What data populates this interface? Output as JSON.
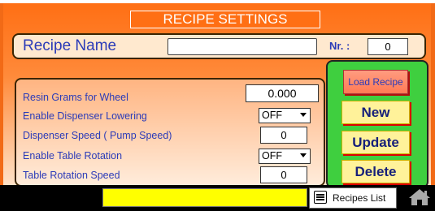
{
  "title": "RECIPE SETTINGS",
  "recipe": {
    "name_label": "Recipe Name",
    "name_value": "",
    "nr_label": "Nr. :",
    "nr_value": "0"
  },
  "params": [
    {
      "label": "Resin Grams for Wheel",
      "value": "0.000"
    },
    {
      "label": "Enable Dispenser Lowering",
      "value": "OFF"
    },
    {
      "label": "Dispenser Speed ( Pump Speed)",
      "value": "0"
    },
    {
      "label": "Enable Table Rotation",
      "value": "OFF"
    },
    {
      "label": "Table Rotation Speed",
      "value": "0"
    }
  ],
  "actions": {
    "load": "Load Recipe",
    "new": "New",
    "update": "Update",
    "delete": "Delete"
  },
  "footer": {
    "status_text": "",
    "recipes_list": "Recipes List"
  },
  "icons": {
    "recipes": "list-icon",
    "home": "home-icon"
  },
  "colors": {
    "panel": "#ff6f14",
    "actions_bg": "#3fcf3f",
    "button_yellow": "#fff29a",
    "label_blue": "#2b3bb8"
  }
}
